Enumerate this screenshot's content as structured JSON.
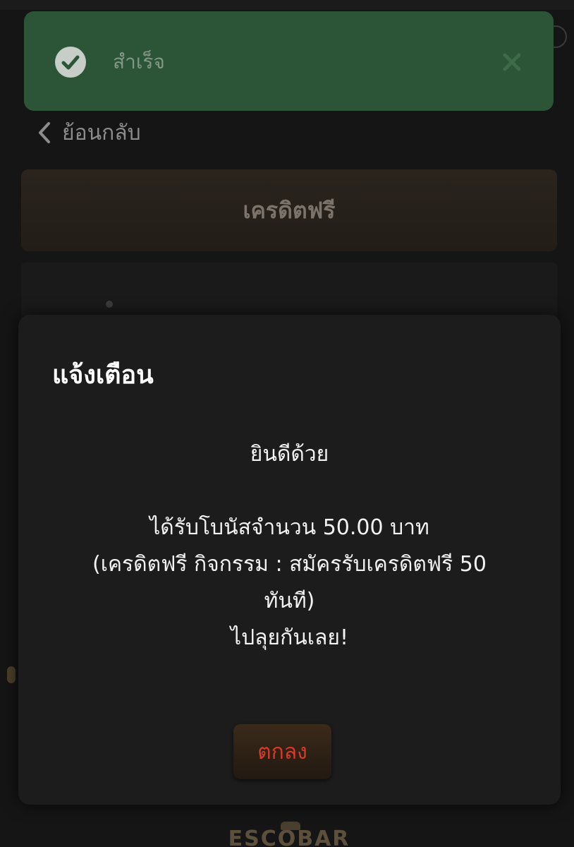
{
  "toast": {
    "message": "สำเร็จ",
    "icon": "check-circle-icon",
    "close_icon": "close-icon",
    "background": "#2c5436"
  },
  "nav": {
    "back_label": "ย้อนกลับ",
    "back_icon": "chevron-left-icon"
  },
  "page": {
    "title": "เครดิตฟรี",
    "logo_text": "ESCOBAR"
  },
  "modal": {
    "title": "แจ้งเตือน",
    "greeting": "ยินดีด้วย",
    "line1": "ได้รับโบนัสจำนวน 50.00 บาท",
    "line2": "(เครดิตฟรี กิจกรรม : สมัครรับเครดิตฟรี 50",
    "line3": "ทันที)",
    "line4": "ไปลุยกันเลย!",
    "ok_label": "ตกลง",
    "ok_color": "#d83a2a"
  }
}
